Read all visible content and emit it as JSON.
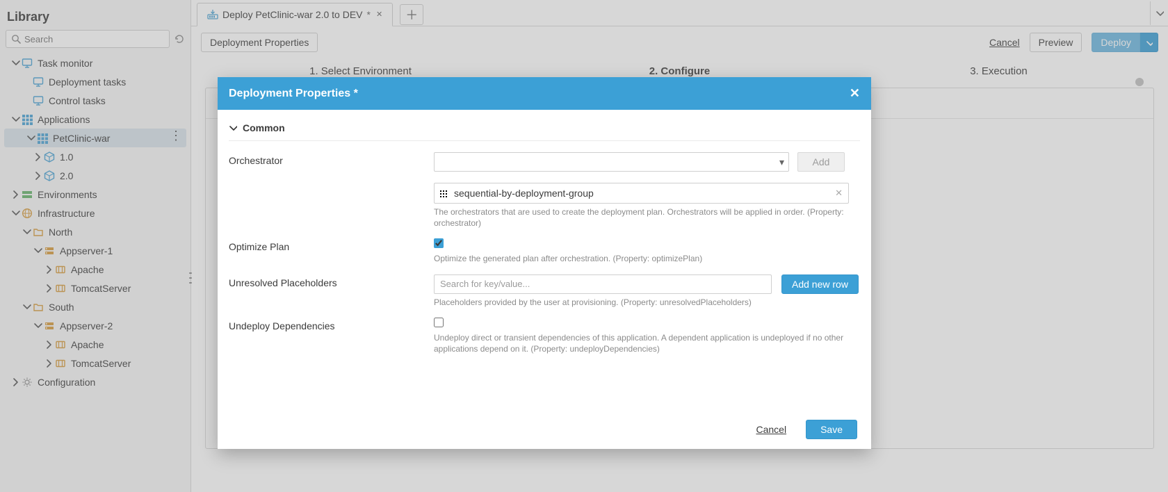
{
  "sidebar": {
    "title": "Library",
    "search_placeholder": "Search",
    "tree": {
      "task_monitor": "Task monitor",
      "deployment_tasks": "Deployment tasks",
      "control_tasks": "Control tasks",
      "applications": "Applications",
      "petclinic": "PetClinic-war",
      "v10": "1.0",
      "v20": "2.0",
      "environments": "Environments",
      "infrastructure": "Infrastructure",
      "north": "North",
      "appserver1": "Appserver-1",
      "apache1": "Apache",
      "tomcat1": "TomcatServer",
      "south": "South",
      "appserver2": "Appserver-2",
      "apache2": "Apache",
      "tomcat2": "TomcatServer",
      "configuration": "Configuration"
    }
  },
  "tabs": {
    "deploy_tab": "Deploy PetClinic-war 2.0 to DEV",
    "dirty_marker": "*"
  },
  "toolbar": {
    "deployment_properties": "Deployment Properties",
    "cancel": "Cancel",
    "preview": "Preview",
    "deploy": "Deploy"
  },
  "wizard": {
    "step1": "1. Select Environment",
    "step2": "2. Configure",
    "step3": "3. Execution"
  },
  "modal": {
    "title": "Deployment Properties *",
    "section_common": "Common",
    "orchestrator": {
      "label": "Orchestrator",
      "add": "Add",
      "chip": "sequential-by-deployment-group",
      "help": "The orchestrators that are used to create the deployment plan. Orchestrators will be applied in order. (Property: orchestrator)"
    },
    "optimize": {
      "label": "Optimize Plan",
      "help": "Optimize the generated plan after orchestration. (Property: optimizePlan)",
      "checked": true
    },
    "placeholders": {
      "label": "Unresolved Placeholders",
      "search_placeholder": "Search for key/value...",
      "add_row": "Add new row",
      "help": "Placeholders provided by the user at provisioning. (Property: unresolvedPlaceholders)"
    },
    "undeploy": {
      "label": "Undeploy Dependencies",
      "help": "Undeploy direct or transient dependencies of this application. A dependent application is undeployed if no other applications depend on it. (Property: undeployDependencies)",
      "checked": false
    },
    "footer_cancel": "Cancel",
    "footer_save": "Save"
  },
  "colors": {
    "accent": "#3ca0d6"
  }
}
